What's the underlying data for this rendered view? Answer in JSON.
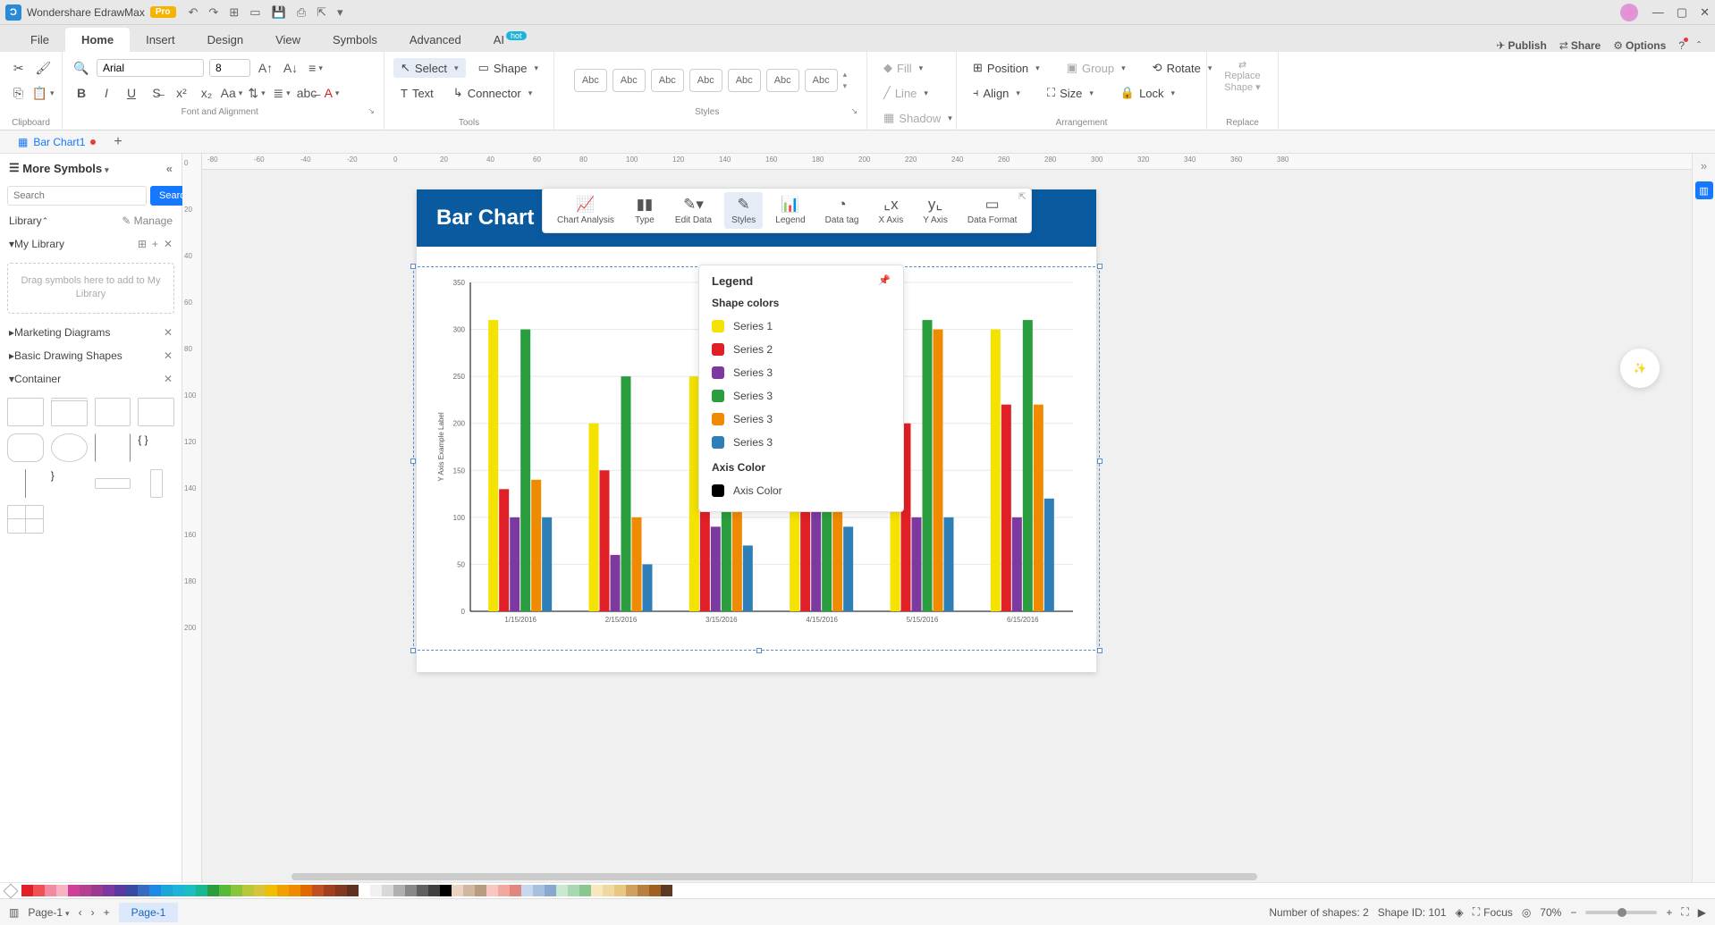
{
  "app": {
    "name": "Wondershare EdrawMax",
    "badge": "Pro"
  },
  "menus": [
    "File",
    "Home",
    "Insert",
    "Design",
    "View",
    "Symbols",
    "Advanced",
    "AI"
  ],
  "menu_active": 1,
  "menu_hot": "hot",
  "menu_right": {
    "publish": "Publish",
    "share": "Share",
    "options": "Options"
  },
  "ribbon": {
    "group_clipboard": "Clipboard",
    "group_font": "Font and Alignment",
    "group_tools": "Tools",
    "group_styles": "Styles",
    "group_arrange": "Arrangement",
    "group_replace": "Replace",
    "font_name": "Arial",
    "font_size": "8",
    "select": "Select",
    "shape": "Shape",
    "text": "Text",
    "connector": "Connector",
    "abc": "Abc",
    "fill": "Fill",
    "line": "Line",
    "shadow": "Shadow",
    "position": "Position",
    "group": "Group",
    "rotate": "Rotate",
    "align": "Align",
    "size": "Size",
    "lock": "Lock",
    "replace_shape": "Replace\nShape",
    "replace": "Replace"
  },
  "tab": {
    "name": "Bar Chart1"
  },
  "left": {
    "title": "More Symbols",
    "search_ph": "Search",
    "search_btn": "Search",
    "library": "Library",
    "manage": "Manage",
    "mylib": "My Library",
    "drop": "Drag symbols here to add to My Library",
    "cat_marketing": "Marketing Diagrams",
    "cat_basic": "Basic Drawing Shapes",
    "cat_container": "Container"
  },
  "hruler_ticks": [
    "-80",
    "-60",
    "-40",
    "-20",
    "0",
    "20",
    "40",
    "60",
    "80",
    "100",
    "120",
    "140",
    "160",
    "180",
    "200",
    "220",
    "240",
    "260",
    "280",
    "300",
    "320",
    "340",
    "360",
    "380"
  ],
  "vruler_ticks": [
    "0",
    "20",
    "40",
    "60",
    "80",
    "100",
    "120",
    "140",
    "160",
    "180",
    "200"
  ],
  "page": {
    "title": "Bar Chart"
  },
  "chart_toolbar": [
    "Chart Analysis",
    "Type",
    "Edit Data",
    "Styles",
    "Legend",
    "Data tag",
    "X Axis",
    "Y Axis",
    "Data Format"
  ],
  "chart_toolbar_active": 3,
  "legend_popup": {
    "title": "Legend",
    "shape_colors": "Shape colors",
    "series": [
      {
        "label": "Series 1",
        "color": "#f4e200"
      },
      {
        "label": "Series 2",
        "color": "#e11f26"
      },
      {
        "label": "Series 3",
        "color": "#7c3aa0"
      },
      {
        "label": "Series 3",
        "color": "#2a9d3f"
      },
      {
        "label": "Series 3",
        "color": "#f08a00"
      },
      {
        "label": "Series 3",
        "color": "#2e7fb8"
      }
    ],
    "axis_color_h": "Axis Color",
    "axis_color_l": "Axis Color"
  },
  "status": {
    "page_dd": "Page-1",
    "page_tab": "Page-1",
    "shapes": "Number of shapes: 2",
    "shape_id": "Shape ID: 101",
    "focus": "Focus",
    "zoom": "70%"
  },
  "chart_data": {
    "type": "bar",
    "title": "Bar Chart",
    "ylabel": "Y Axis Example Label",
    "ylim": [
      0,
      350
    ],
    "yticks": [
      0,
      50,
      100,
      150,
      200,
      250,
      300,
      350
    ],
    "categories": [
      "1/15/2016",
      "2/15/2016",
      "3/15/2016",
      "4/15/2016",
      "5/15/2016",
      "6/15/2016"
    ],
    "series": [
      {
        "name": "Series 1",
        "color": "#f4e200",
        "values": [
          310,
          200,
          250,
          270,
          300,
          300
        ]
      },
      {
        "name": "Series 2",
        "color": "#e11f26",
        "values": [
          130,
          150,
          170,
          190,
          200,
          220
        ]
      },
      {
        "name": "Series 3",
        "color": "#7c3aa0",
        "values": [
          100,
          60,
          90,
          150,
          100,
          100
        ]
      },
      {
        "name": "Series 3",
        "color": "#2a9d3f",
        "values": [
          300,
          250,
          280,
          300,
          310,
          310
        ]
      },
      {
        "name": "Series 3",
        "color": "#f08a00",
        "values": [
          140,
          100,
          120,
          350,
          300,
          220
        ]
      },
      {
        "name": "Series 3",
        "color": "#2e7fb8",
        "values": [
          100,
          50,
          70,
          90,
          100,
          120
        ]
      }
    ]
  },
  "palette": [
    "#e11f26",
    "#f05056",
    "#f28aa0",
    "#f5b4c4",
    "#d04098",
    "#b44090",
    "#9c3a90",
    "#7c3aa0",
    "#5a3aa0",
    "#3a4aa0",
    "#3a6ac0",
    "#1e88e5",
    "#1aa6d6",
    "#1db4d8",
    "#1ac0c0",
    "#1ab890",
    "#2a9d3f",
    "#5ab83a",
    "#8ac43a",
    "#b8c83a",
    "#d8c43a",
    "#f0c000",
    "#f0a000",
    "#f08a00",
    "#e06a00",
    "#c05020",
    "#a04020",
    "#803a20",
    "#603020",
    "#ffffff",
    "#f0f0f0",
    "#d8d8d8",
    "#b0b0b0",
    "#888888",
    "#606060",
    "#404040",
    "#000000",
    "#e8d4c0",
    "#d0b8a0",
    "#b89c80",
    "#f8c8c0",
    "#f0a8a0",
    "#e08880",
    "#c8d8f0",
    "#a8c0e0",
    "#88a8d0",
    "#c8e8d0",
    "#a8d8b0",
    "#88c890",
    "#f8e8c0",
    "#f0d8a0",
    "#e8c880",
    "#d0a060",
    "#b88040",
    "#a06020",
    "#5a3a20"
  ]
}
